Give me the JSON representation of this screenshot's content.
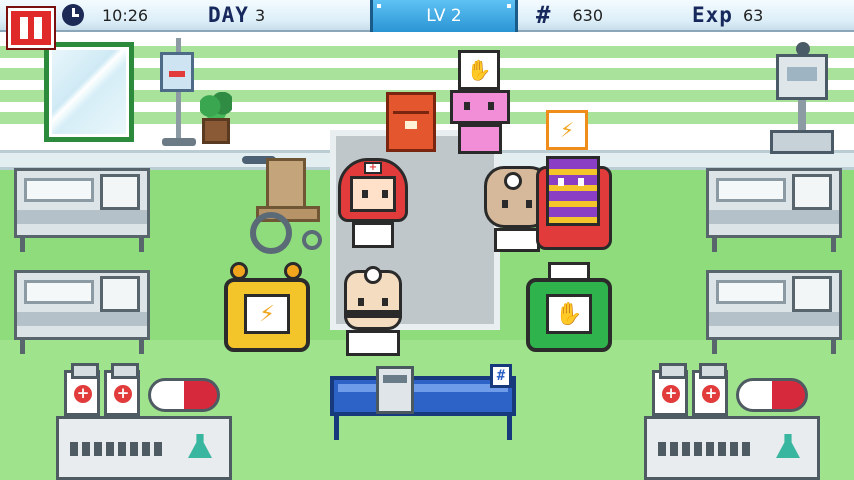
{
  "hud": {
    "time": "10:26",
    "day_label": "DAY",
    "day_value": "3",
    "level": "LV 2",
    "money": "630",
    "exp_label": "Exp",
    "exp_value": "63"
  },
  "icons": {
    "pause": "pause-icon",
    "clock": "clock-icon",
    "money": "hash-icon",
    "register_badge": "#"
  },
  "patients": [
    {
      "name": "pink-patient",
      "need": "hand-icon",
      "need_color": "#2fa84a"
    },
    {
      "name": "striped-patient",
      "need": "lightning-icon",
      "need_color": "#f0a51d"
    }
  ],
  "colors": {
    "pause_bg": "#e02a2a",
    "level_bg": "#2a94d4",
    "floor": "#8fdc7c",
    "wall_stripe": "#a9e29b",
    "desk": "#2d62c6",
    "yellow_machine": "#f3c52b",
    "green_machine": "#2fb34c",
    "nurse_hair": "#e23b3b"
  }
}
